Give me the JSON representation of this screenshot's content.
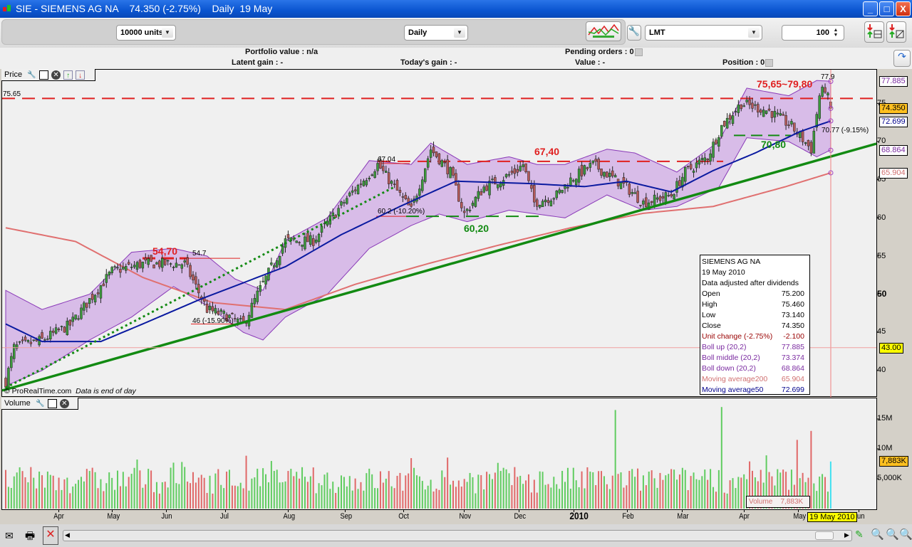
{
  "window": {
    "title": "SIE - SIEMENS AG NA    74.350 (-2.75%)    Daily  19 May",
    "min": "_",
    "max": "□",
    "close": "X"
  },
  "toolbar": {
    "units": "10000 units",
    "period": "Daily",
    "order_type": "LMT",
    "quantity": "100"
  },
  "info": {
    "portfolio_value": "Portfolio value : n/a",
    "latent_gain": "Latent gain : -",
    "todays_gain": "Today's gain : -",
    "pending_orders": "Pending orders : 0",
    "value": "Value : -",
    "position": "Position : 0"
  },
  "price_panel": {
    "title": "Price",
    "watermark": "© ProRealTime.com",
    "watermark_note": "Data is end of day"
  },
  "volume_panel": {
    "title": "Volume",
    "legend_label": "Volume",
    "legend_value": "7,883K"
  },
  "infobox": {
    "name": "SIEMENS AG NA",
    "date": "19 May 2010",
    "note": "Data adjusted after dividends",
    "rows": [
      {
        "label": "Open",
        "value": "75.200",
        "color": "#000000"
      },
      {
        "label": "High",
        "value": "75.460",
        "color": "#000000"
      },
      {
        "label": "Low",
        "value": "73.140",
        "color": "#000000"
      },
      {
        "label": "Close",
        "value": "74.350",
        "color": "#000000"
      },
      {
        "label": "Unit change (-2.75%)",
        "value": "-2.100",
        "color": "#990000"
      },
      {
        "label": "Boll up (20,2)",
        "value": "77.885",
        "color": "#7a2aa0"
      },
      {
        "label": "Boll middle (20,2)",
        "value": "73.374",
        "color": "#7a2aa0"
      },
      {
        "label": "Boll down (20,2)",
        "value": "68.864",
        "color": "#7a2aa0"
      },
      {
        "label": "Moving average200",
        "value": "65.904",
        "color": "#d07070"
      },
      {
        "label": "Moving average50",
        "value": "72.699",
        "color": "#00008b"
      }
    ]
  },
  "annotations": {
    "resist_top": "75,65~79,80",
    "resist_top_left": "75.65",
    "high_label": "77.9",
    "resist_mid": "67,40",
    "resist_mid_small": "67.04",
    "support_mid": "60,20",
    "support_mid_small": "60.2 (-10.20%)",
    "resist_low": "54,70",
    "resist_low_small": "54.7",
    "support_low_small": "46 (-15.90%)",
    "support_top": "70,80",
    "support_top_small": "70.77 (-9.15%)"
  },
  "price_axis": {
    "ticks": [
      "75",
      "70",
      "65",
      "60",
      "55",
      "50",
      "45",
      "40"
    ],
    "tags": {
      "boll_up": "77.885",
      "close": "74.350",
      "ma50": "72.699",
      "boll_down": "68.864",
      "ma200": "65.904",
      "cursor": "43.00"
    }
  },
  "volume_axis": {
    "ticks": [
      "15M",
      "10M",
      "5,000K"
    ],
    "current": "7,883K"
  },
  "x_axis": {
    "labels": [
      "Apr",
      "May",
      "Jun",
      "Jul",
      "Aug",
      "Sep",
      "Oct",
      "Nov",
      "Dec",
      "2010",
      "Feb",
      "Mar",
      "Apr",
      "May",
      "Jun"
    ],
    "cursor_date": "19 May 2010"
  },
  "colors": {
    "up": "#3c9a3c",
    "down": "#b45a5a",
    "band": "#d8bce8",
    "ma50": "#0a1aa0",
    "ma200": "#e07070",
    "trend": "#128a12",
    "resist": "#e02020"
  },
  "chart_data": {
    "type": "candlestick",
    "days": 296,
    "price_range": [
      37,
      80
    ],
    "close_anchors": [
      [
        0,
        38.5
      ],
      [
        3,
        43
      ],
      [
        13,
        44
      ],
      [
        23,
        46
      ],
      [
        38,
        53
      ],
      [
        49,
        54
      ],
      [
        64,
        54
      ],
      [
        72,
        48
      ],
      [
        80,
        47
      ],
      [
        85,
        46
      ],
      [
        90,
        50
      ],
      [
        100,
        57
      ],
      [
        110,
        57
      ],
      [
        123,
        63
      ],
      [
        133,
        67
      ],
      [
        141,
        63
      ],
      [
        145,
        61
      ],
      [
        152,
        69
      ],
      [
        159,
        66
      ],
      [
        164,
        60.5
      ],
      [
        171,
        64
      ],
      [
        182,
        66
      ],
      [
        185,
        67
      ],
      [
        189,
        62
      ],
      [
        197,
        63
      ],
      [
        202,
        65
      ],
      [
        210,
        67
      ],
      [
        222,
        64
      ],
      [
        228,
        62
      ],
      [
        238,
        63
      ],
      [
        243,
        66
      ],
      [
        251,
        68
      ],
      [
        256,
        72
      ],
      [
        263,
        75
      ],
      [
        273,
        74
      ],
      [
        281,
        72
      ],
      [
        288,
        69
      ],
      [
        291,
        76
      ],
      [
        293,
        77
      ],
      [
        295,
        74.35
      ]
    ],
    "ma200": [
      [
        0,
        58.7
      ],
      [
        25,
        56.9
      ],
      [
        49,
        52.2
      ],
      [
        74,
        48.9
      ],
      [
        100,
        48
      ],
      [
        125,
        51.3
      ],
      [
        151,
        54
      ],
      [
        176,
        56.4
      ],
      [
        202,
        58.7
      ],
      [
        228,
        60.6
      ],
      [
        253,
        61.5
      ],
      [
        279,
        64.1
      ],
      [
        295,
        65.9
      ]
    ],
    "ma50": [
      [
        0,
        46.1
      ],
      [
        13,
        43.8
      ],
      [
        34,
        43.8
      ],
      [
        49,
        46.1
      ],
      [
        70,
        49.4
      ],
      [
        80,
        50.8
      ],
      [
        100,
        53.6
      ],
      [
        120,
        57.8
      ],
      [
        141,
        61.5
      ],
      [
        161,
        64.8
      ],
      [
        187,
        64.5
      ],
      [
        207,
        64.1
      ],
      [
        222,
        64.8
      ],
      [
        238,
        63.4
      ],
      [
        253,
        66.2
      ],
      [
        268,
        68.5
      ],
      [
        284,
        71.3
      ],
      [
        295,
        72.7
      ]
    ],
    "boll_up": [
      [
        0,
        50.5
      ],
      [
        13,
        48
      ],
      [
        30,
        50
      ],
      [
        45,
        55.5
      ],
      [
        60,
        56
      ],
      [
        72,
        55
      ],
      [
        82,
        52
      ],
      [
        92,
        50.5
      ],
      [
        100,
        57
      ],
      [
        115,
        60
      ],
      [
        130,
        67.5
      ],
      [
        145,
        67
      ],
      [
        152,
        69.8
      ],
      [
        165,
        67
      ],
      [
        180,
        68
      ],
      [
        190,
        67
      ],
      [
        200,
        67
      ],
      [
        215,
        69
      ],
      [
        225,
        68.5
      ],
      [
        240,
        66
      ],
      [
        255,
        70
      ],
      [
        265,
        77
      ],
      [
        280,
        76
      ],
      [
        290,
        78
      ],
      [
        295,
        77.9
      ]
    ],
    "boll_down": [
      [
        0,
        38
      ],
      [
        13,
        40
      ],
      [
        30,
        44
      ],
      [
        45,
        47
      ],
      [
        60,
        51
      ],
      [
        72,
        48.5
      ],
      [
        85,
        45
      ],
      [
        92,
        44
      ],
      [
        100,
        47
      ],
      [
        115,
        50
      ],
      [
        130,
        56
      ],
      [
        145,
        59
      ],
      [
        155,
        60.5
      ],
      [
        165,
        59.5
      ],
      [
        180,
        61
      ],
      [
        190,
        60.5
      ],
      [
        200,
        60
      ],
      [
        215,
        63
      ],
      [
        228,
        61
      ],
      [
        240,
        61.5
      ],
      [
        255,
        64
      ],
      [
        265,
        70.5
      ],
      [
        280,
        70
      ],
      [
        290,
        68
      ],
      [
        295,
        68.9
      ]
    ],
    "volume_range_M": [
      0,
      18
    ],
    "volume_spikes_M": [
      [
        218,
        16.5
      ],
      [
        256,
        17
      ],
      [
        283,
        11.5
      ],
      [
        288,
        13
      ],
      [
        295,
        7.883
      ]
    ],
    "levels": {
      "resist_top": 75.65,
      "resist_mid": 67.4,
      "support_mid": 60.2,
      "resist_low": 54.7,
      "support_low": 46,
      "support_top": 70.8,
      "cursor": 43
    }
  }
}
